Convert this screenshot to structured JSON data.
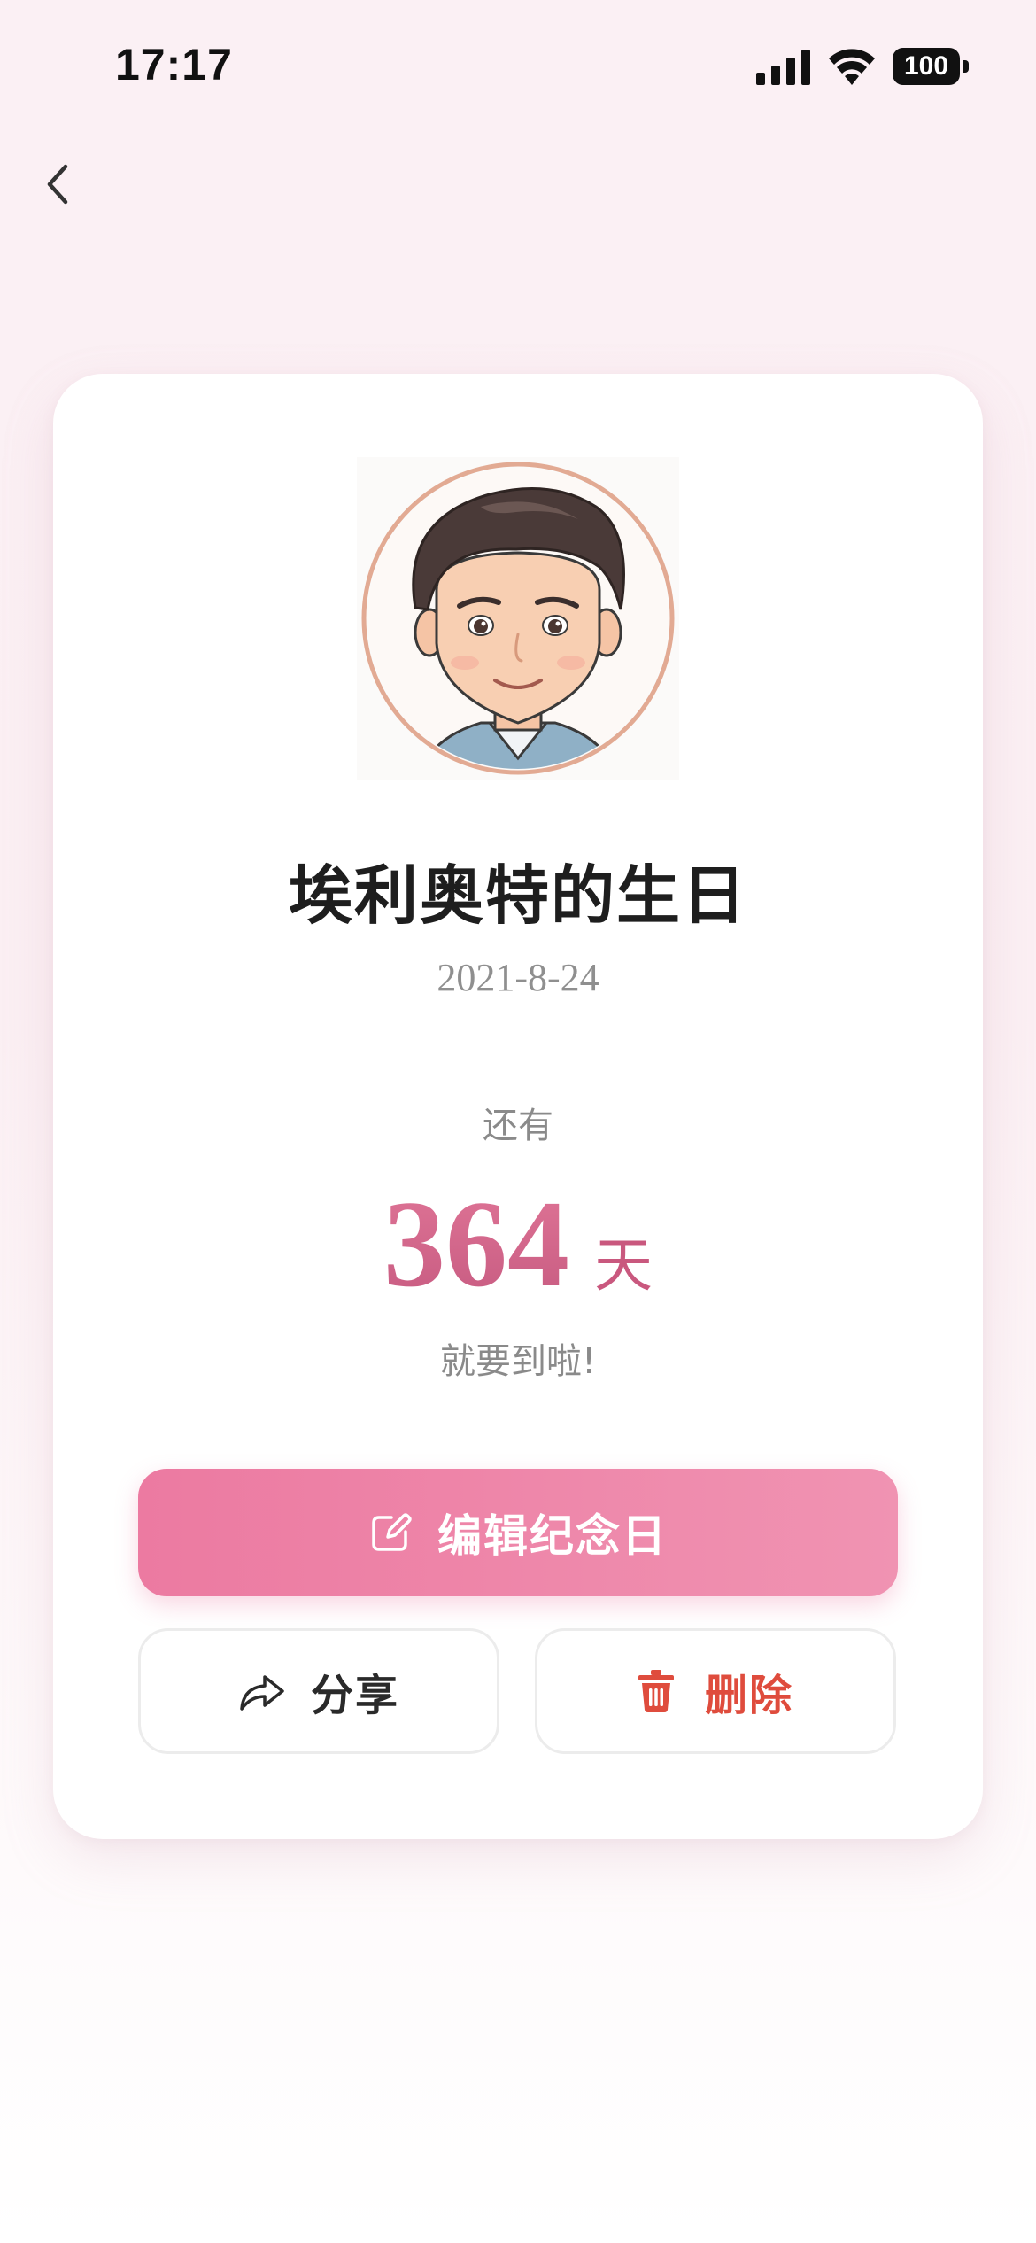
{
  "status_bar": {
    "time": "17:17",
    "battery_level": "100",
    "signal_icon": "cellular-signal-icon",
    "wifi_icon": "wifi-icon"
  },
  "nav": {
    "back_icon": "chevron-left-icon"
  },
  "card": {
    "avatar_icon": "cartoon-man-avatar",
    "title": "埃利奥特的生日",
    "date": "2021-8-24",
    "remaining_label": "还有",
    "days_count": "364",
    "days_unit": "天",
    "arrival_text": "就要到啦!"
  },
  "actions": {
    "edit_label": "编辑纪念日",
    "edit_icon": "edit-square-icon",
    "share_label": "分享",
    "share_icon": "share-arrow-icon",
    "delete_label": "删除",
    "delete_icon": "trash-icon"
  },
  "colors": {
    "accent_pink": "#EC7AA1",
    "countdown_pink": "#D9678C",
    "delete_red": "#DF4C3D",
    "background": "#FBF0F4"
  }
}
